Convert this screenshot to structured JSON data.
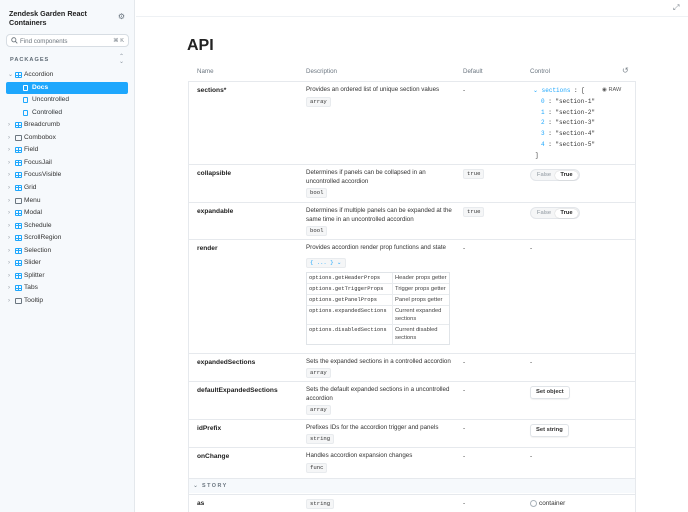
{
  "sidebar": {
    "title": "Zendesk Garden React Containers",
    "search_placeholder": "Find components",
    "search_shortcut": "⌘ K",
    "section_label": "PACKAGES",
    "items": [
      {
        "label": "Accordion",
        "type": "component",
        "expanded": true
      },
      {
        "label": "Breadcrumb",
        "type": "component"
      },
      {
        "label": "Combobox",
        "type": "folder"
      },
      {
        "label": "Field",
        "type": "component"
      },
      {
        "label": "FocusJail",
        "type": "component"
      },
      {
        "label": "FocusVisible",
        "type": "component"
      },
      {
        "label": "Grid",
        "type": "component"
      },
      {
        "label": "Menu",
        "type": "folder"
      },
      {
        "label": "Modal",
        "type": "component"
      },
      {
        "label": "Schedule",
        "type": "component"
      },
      {
        "label": "ScrollRegion",
        "type": "component"
      },
      {
        "label": "Selection",
        "type": "component"
      },
      {
        "label": "Slider",
        "type": "component"
      },
      {
        "label": "Splitter",
        "type": "component"
      },
      {
        "label": "Tabs",
        "type": "component"
      },
      {
        "label": "Tooltip",
        "type": "folder"
      }
    ],
    "accordion_children": [
      {
        "label": "Docs",
        "active": true
      },
      {
        "label": "Uncontrolled"
      },
      {
        "label": "Controlled"
      }
    ]
  },
  "main": {
    "title": "API",
    "columns": {
      "name": "Name",
      "description": "Description",
      "default": "Default",
      "control": "Control"
    },
    "rows": {
      "sections": {
        "name": "sections*",
        "desc": "Provides an ordered list of unique section values",
        "type": "array",
        "default": "-"
      },
      "collapsible": {
        "name": "collapsible",
        "desc": "Determines if panels can be collapsed in an uncontrolled accordion",
        "type": "bool",
        "default": "true"
      },
      "expandable": {
        "name": "expandable",
        "desc": "Determines if multiple panels can be expanded at the same time in an uncontrolled accordion",
        "type": "bool",
        "default": "true"
      },
      "render": {
        "name": "render",
        "desc": "Provides accordion render prop functions and state",
        "default": "-",
        "control": "-",
        "summary": "{ ... }"
      },
      "expandedSections": {
        "name": "expandedSections",
        "desc": "Sets the expanded sections in a controlled accordion",
        "type": "array",
        "default": "-",
        "control": "-"
      },
      "defaultExpandedSections": {
        "name": "defaultExpandedSections",
        "desc": "Sets the default expanded sections in a uncontrolled accordion",
        "type": "array",
        "default": "-",
        "control": "Set object"
      },
      "idPrefix": {
        "name": "idPrefix",
        "desc": "Prefixes IDs for the accordion trigger and panels",
        "type": "string",
        "default": "-",
        "control": "Set string"
      },
      "onChange": {
        "name": "onChange",
        "desc": "Handles accordion expansion changes",
        "type": "func",
        "default": "-",
        "control": "-"
      },
      "as": {
        "name": "as",
        "type": "string",
        "default": "-",
        "control": "container"
      }
    },
    "render_props": [
      {
        "key": "options.getHeaderProps",
        "value": "Header props getter"
      },
      {
        "key": "options.getTriggerProps",
        "value": "Trigger props getter"
      },
      {
        "key": "options.getPanelProps",
        "value": "Panel props getter"
      },
      {
        "key": "options.expandedSections",
        "value": "Current expanded sections"
      },
      {
        "key": "options.disabledSections",
        "value": "Current disabled sections"
      }
    ],
    "sections_control": {
      "key": "sections",
      "open": "[",
      "close": "]",
      "raw_label": "RAW",
      "items": [
        {
          "i": "0",
          "v": "\"section-1\""
        },
        {
          "i": "1",
          "v": "\"section-2\""
        },
        {
          "i": "2",
          "v": "\"section-3\""
        },
        {
          "i": "3",
          "v": "\"section-4\""
        },
        {
          "i": "4",
          "v": "\"section-5\""
        }
      ]
    },
    "toggle": {
      "false_label": "False",
      "true_label": "True"
    },
    "story_label": "STORY"
  },
  "colors": {
    "accent": "#1ea7fd"
  }
}
